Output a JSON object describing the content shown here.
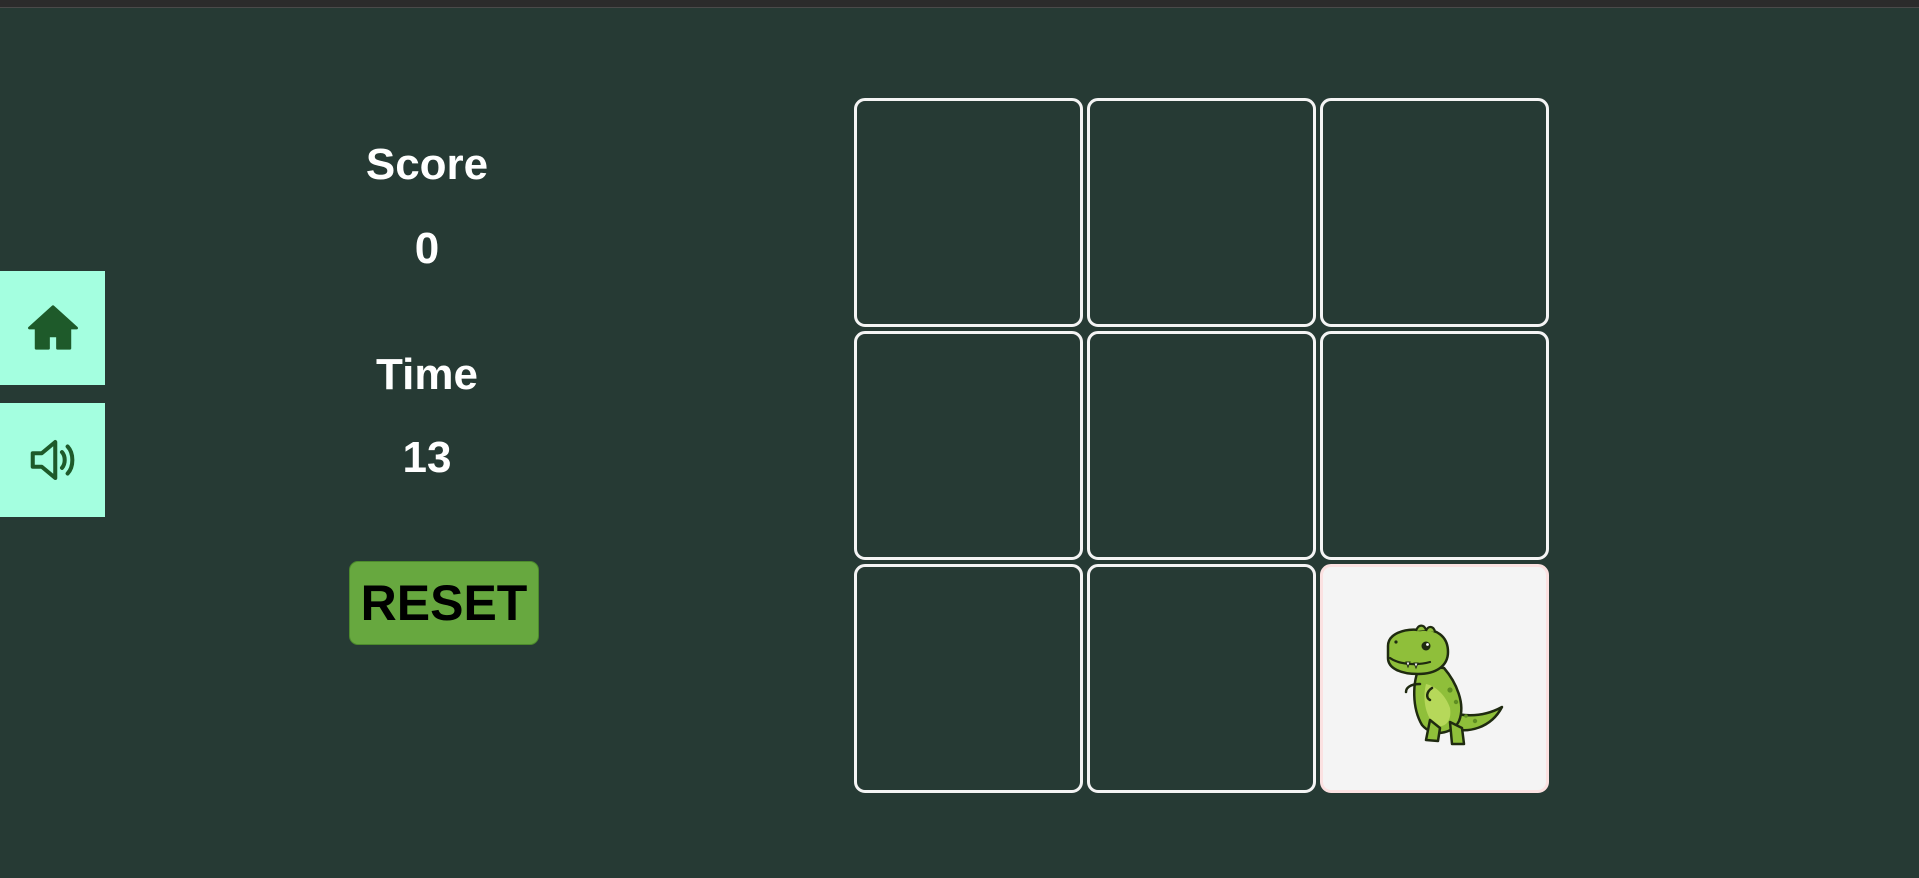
{
  "sidebar": {
    "home_icon": "home-icon",
    "sound_icon": "speaker-icon",
    "background_color": "#a4ffe0",
    "icon_color": "#1e5a2a"
  },
  "stats": {
    "score_label": "Score",
    "score_value": "0",
    "time_label": "Time",
    "time_value": "13"
  },
  "controls": {
    "reset_label": "RESET",
    "reset_color": "#67a83f"
  },
  "board": {
    "rows": 3,
    "cols": 3,
    "active_cell": 8,
    "active_image": "dinosaur-icon",
    "background_color": "#263a34",
    "cell_border_color": "#f4f4f4"
  }
}
